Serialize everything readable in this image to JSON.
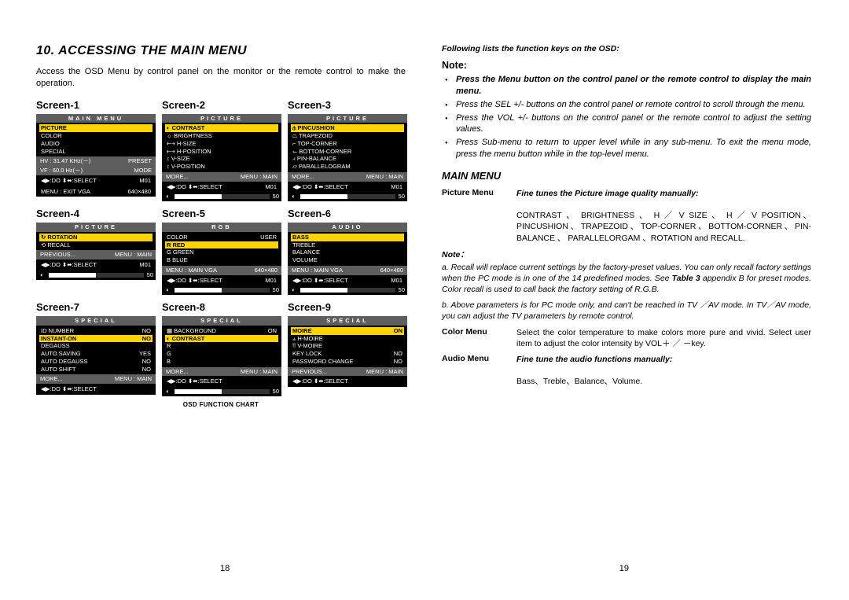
{
  "left": {
    "title": "10. ACCESSING THE MAIN MENU",
    "intro": "Access the OSD Menu by control panel on the monitor or the remote control to make the operation.",
    "screens": {
      "s1": {
        "label": "Screen-1",
        "header": "MAIN MENU",
        "rows": [
          [
            "PICTURE",
            ""
          ],
          [
            "COLOR",
            ""
          ],
          [
            "AUDIO",
            ""
          ],
          [
            "SPECIAL",
            ""
          ]
        ],
        "sel": 0,
        "status": [
          [
            "HV : 31.47 KHz(－)",
            "PRESET"
          ],
          [
            "VF : 60.0   Hz(－)",
            "MODE"
          ]
        ],
        "foot": [
          [
            "◀▶:DO  ⬍⬌:SELECT",
            "M01"
          ],
          [
            "MENU : EXIT   VGA",
            "640×480"
          ]
        ]
      },
      "s2": {
        "label": "Screen-2",
        "header": "PICTURE",
        "rows": [
          [
            "◐ CONTRAST",
            ""
          ],
          [
            "☼ BRIGHTNESS",
            ""
          ],
          [
            "⟷ H-SIZE",
            ""
          ],
          [
            "⟷ H-POSITION",
            ""
          ],
          [
            "↕ V-SIZE",
            ""
          ],
          [
            "↕ V-POSITION",
            ""
          ]
        ],
        "sel": 0,
        "status": [
          [
            "MORE...",
            "MENU : MAIN"
          ]
        ],
        "foot": [
          [
            "◀▶:DO  ⬍⬌:SELECT",
            "M01"
          ]
        ],
        "bar": "50"
      },
      "s3": {
        "label": "Screen-3",
        "header": "PICTURE",
        "rows": [
          [
            "⫛ PINCUSHION",
            ""
          ],
          [
            "⏢ TRAPEZOID",
            ""
          ],
          [
            "⌐ TOP-CORNER",
            ""
          ],
          [
            "⌙ BOTTOM-CORNER",
            ""
          ],
          [
            "⫞ PIN-BALANCE",
            ""
          ],
          [
            "▱ PARALLELOGRAM",
            ""
          ]
        ],
        "sel": 0,
        "status": [
          [
            "MORE...",
            "MENU : MAIN"
          ]
        ],
        "foot": [
          [
            "◀▶:DO  ⬍⬌:SELECT",
            "M01"
          ]
        ],
        "bar": "50"
      },
      "s4": {
        "label": "Screen-4",
        "header": "PICTURE",
        "rows": [
          [
            "↻ ROTATION",
            ""
          ],
          [
            "⟲ RECALL",
            ""
          ]
        ],
        "sel": 0,
        "status": [
          [
            "PREVIOUS...",
            "MENU : MAIN"
          ]
        ],
        "foot": [
          [
            "◀▶:DO  ⬍⬌:SELECT",
            "M01"
          ]
        ],
        "bar": "50"
      },
      "s5": {
        "label": "Screen-5",
        "header": "RGB",
        "rows": [
          [
            "COLOR",
            "USER"
          ],
          [
            "R RED",
            ""
          ],
          [
            "G GREEN",
            ""
          ],
          [
            "B BLUE",
            ""
          ]
        ],
        "sel": 1,
        "status": [
          [
            "MENU : MAIN   VGA",
            "640×480"
          ]
        ],
        "foot": [
          [
            "◀▶:DO  ⬍⬌:SELECT",
            "M01"
          ]
        ],
        "bar": "50"
      },
      "s6": {
        "label": "Screen-6",
        "header": "AUDIO",
        "rows": [
          [
            "BASS",
            ""
          ],
          [
            "TREBLE",
            ""
          ],
          [
            "BALANCE",
            ""
          ],
          [
            "VOLUME",
            ""
          ]
        ],
        "sel": 0,
        "status": [
          [
            "MENU : MAIN   VGA",
            "640×480"
          ]
        ],
        "foot": [
          [
            "◀▶:DO  ⬍⬌:SELECT",
            "M01"
          ]
        ],
        "bar": "50"
      },
      "s7": {
        "label": "Screen-7",
        "header": "SPECIAL",
        "rows": [
          [
            "ID NUMBER",
            "NO"
          ],
          [
            "INSTANT-ON",
            "NO"
          ],
          [
            "DEGAUSS",
            ""
          ],
          [
            "AUTO SAVING",
            "YES"
          ],
          [
            "AUTO DEGAUSS",
            "NO"
          ],
          [
            "AUTO SHIFT",
            "NO"
          ]
        ],
        "sel": 1,
        "status": [
          [
            "MORE...",
            "MENU : MAIN"
          ]
        ],
        "foot": [
          [
            "◀▶:DO  ⬍⬌:SELECT",
            ""
          ]
        ]
      },
      "s8": {
        "label": "Screen-8",
        "header": "SPECIAL",
        "rows": [
          [
            "▦ BACKGROUND",
            "ON"
          ],
          [
            "◐ CONTRAST",
            ""
          ],
          [
            "R",
            ""
          ],
          [
            "G",
            ""
          ],
          [
            "B",
            ""
          ]
        ],
        "sel": 1,
        "status": [
          [
            "MORE...",
            "MENU : MAIN"
          ]
        ],
        "foot": [
          [
            "◀▶:DO  ⬍⬌:SELECT",
            ""
          ]
        ],
        "bar": "50"
      },
      "s9": {
        "label": "Screen-9",
        "header": "SPECIAL",
        "rows": [
          [
            "MOIRE",
            "ON"
          ],
          [
            "⫨ H-MOIRE",
            ""
          ],
          [
            "⫪ V-MOIRE",
            ""
          ],
          [
            "KEY LOCK",
            "NO"
          ],
          [
            "PASSWORD CHANGE",
            "NO"
          ]
        ],
        "sel": 0,
        "status": [
          [
            "PREVIOUS...",
            "MENU : MAIN"
          ]
        ],
        "foot": [
          [
            "◀▶:DO  ⬍⬌:SELECT",
            ""
          ]
        ]
      }
    },
    "caption": "OSD FUNCTION CHART",
    "pagenum": "18"
  },
  "right": {
    "funcintro": "Following lists the function keys on the OSD:",
    "notehead": "Note:",
    "bullets": [
      {
        "bold": true,
        "text": "Press the Menu button on the control panel or the remote control to display the main menu."
      },
      {
        "bold": false,
        "text": "Press the SEL +/- buttons on the control panel or remote control to scroll through the menu."
      },
      {
        "bold": false,
        "text": "Press the VOL +/- buttons on the control panel or the remote control to adjust the setting values."
      },
      {
        "bold": false,
        "text": "Press Sub-menu to return to upper level while in any sub-menu. To exit the menu mode, press the menu button while in the top-level menu."
      }
    ],
    "mainmenu": "MAIN MENU",
    "picmenu": {
      "label": "Picture Menu",
      "lead": "Fine tunes the Picture image quality manually:",
      "body": "CONTRAST 、 BRIGHTNESS 、 H ／ V  SIZE 、 H ／ V POSITION、PINCUSHION、TRAPEZOID、TOP-CORNER、BOTTOM-CORNER、PIN-BALANCE 、 PARALLELORGAM 、ROTATION and RECALL."
    },
    "note2": "Note：",
    "na": "a. Recall will replace current settings by the factory-preset values. You can only recall factory settings when the PC mode is in one of the 14 predefined modes.  See Table 3 appendix B for preset modes. Color recall is used to call back the factory setting of R.G.B.",
    "nb": "b. Above parameters is for PC mode only, and can't be reached in TV ／AV mode.  In TV／AV mode, you can adjust the TV parameters by remote control.",
    "colormenu": {
      "label": "Color Menu",
      "body": "Select the color temperature to make colors more pure and vivid.  Select user item to adjust the color intensity by VOL＋ ／ －key."
    },
    "audiomenu": {
      "label": "Audio Menu",
      "lead": "Fine tune the audio functions manually:",
      "body": "Bass、Treble、Balance、Volume."
    },
    "pagenum": "19"
  }
}
